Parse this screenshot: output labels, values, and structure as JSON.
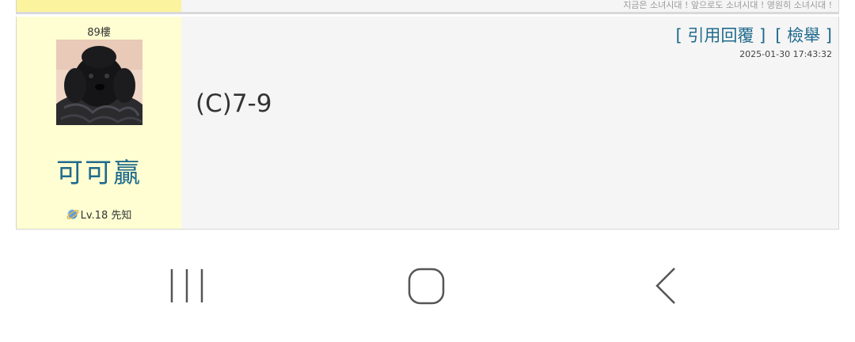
{
  "prev_post": {
    "signature": "지금은 소녀시대 ! 앞으로도 소녀시대 ! 영원히 소녀시대 !"
  },
  "post": {
    "floor": "89樓",
    "author": {
      "name": "可可贏",
      "level": "Lv.18 先知",
      "avatar_icon": "poodle-avatar"
    },
    "actions": {
      "quote_reply": "[ 引用回覆 ]",
      "report": "[ 檢舉 ]"
    },
    "timestamp": "2025-01-30 17:43:32",
    "body": "(C)7-9"
  },
  "navbar": {
    "recent_icon": "recent-apps-icon",
    "home_icon": "home-icon",
    "back_icon": "back-icon"
  },
  "colors": {
    "author_bg": "#fefed2",
    "prev_author_bg": "#fbf39e",
    "link": "#1f6a8c",
    "post_bg": "#f5f5f5"
  }
}
